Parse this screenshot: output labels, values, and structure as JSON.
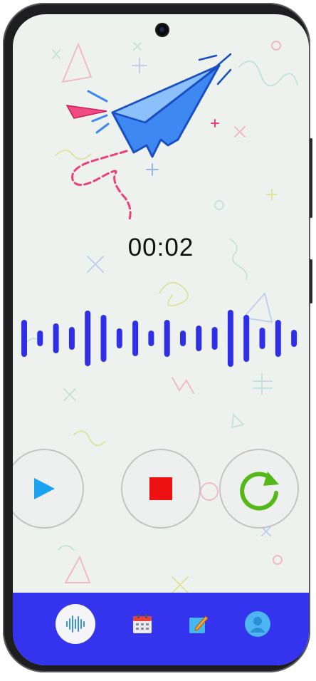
{
  "recorder": {
    "timer": "00:02"
  },
  "icons": {
    "illustration": "paper-plane-illustration",
    "play": "play-icon",
    "stop": "stop-icon",
    "reset": "refresh-icon"
  },
  "navigation": {
    "items": [
      {
        "name": "waveform-icon",
        "active": true
      },
      {
        "name": "calendar-icon",
        "active": false
      },
      {
        "name": "notes-icon",
        "active": false
      },
      {
        "name": "profile-icon",
        "active": false
      }
    ]
  },
  "colors": {
    "wave_bar": "#2f2fe8",
    "play": "#1aa3ee",
    "stop": "#ee1111",
    "reset": "#53b818",
    "nav_background": "#3434ee"
  }
}
